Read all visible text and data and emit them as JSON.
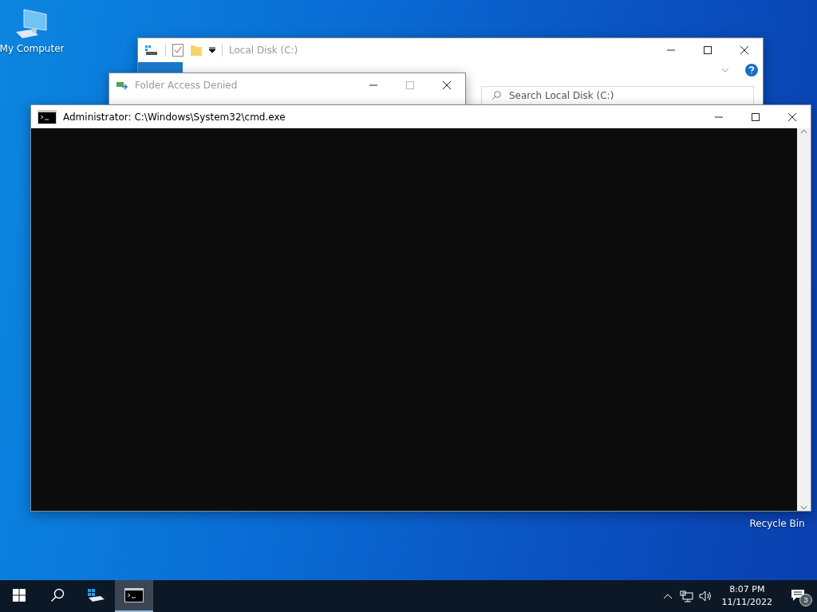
{
  "desktop_icons": [
    {
      "kind": "computer",
      "label": "My Computer"
    },
    {
      "kind": "recycle",
      "label": "Recycle Bin"
    }
  ],
  "explorer": {
    "title": "Local Disk (C:)",
    "search": {
      "placeholder": "Search Local Disk (C:)"
    }
  },
  "dialog": {
    "title": "Folder Access Denied"
  },
  "console": {
    "title": "Administrator: C:\\Windows\\System32\\cmd.exe"
  },
  "taskbar": {
    "apps": [
      {
        "kind": "explorer",
        "selected": false
      },
      {
        "kind": "console",
        "selected": true
      }
    ],
    "time": "8:07 PM",
    "date": "11/11/2022",
    "notification_count": "3"
  }
}
